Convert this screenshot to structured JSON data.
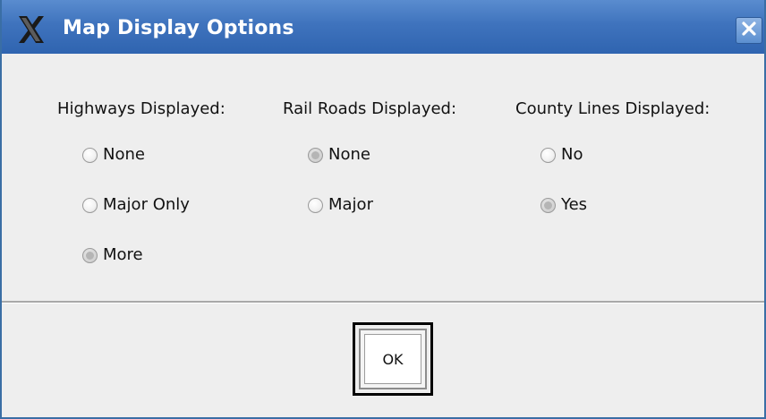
{
  "window": {
    "title": "Map Display Options",
    "colors": {
      "titlebar": "#3f73bd",
      "background": "#eeeeee",
      "border": "#3a6ea5"
    }
  },
  "icons": {
    "app": "x-logo-icon",
    "close": "close-icon",
    "radio": "radio-button-icon"
  },
  "groups": [
    {
      "label": "Highways Displayed:",
      "options": [
        {
          "label": "None",
          "selected": false
        },
        {
          "label": "Major Only",
          "selected": false
        },
        {
          "label": "More",
          "selected": true
        }
      ]
    },
    {
      "label": "Rail Roads Displayed:",
      "options": [
        {
          "label": "None",
          "selected": true
        },
        {
          "label": "Major",
          "selected": false
        }
      ]
    },
    {
      "label": "County Lines Displayed:",
      "options": [
        {
          "label": "No",
          "selected": false
        },
        {
          "label": "Yes",
          "selected": true
        }
      ]
    }
  ],
  "footer": {
    "ok_label": "OK"
  }
}
